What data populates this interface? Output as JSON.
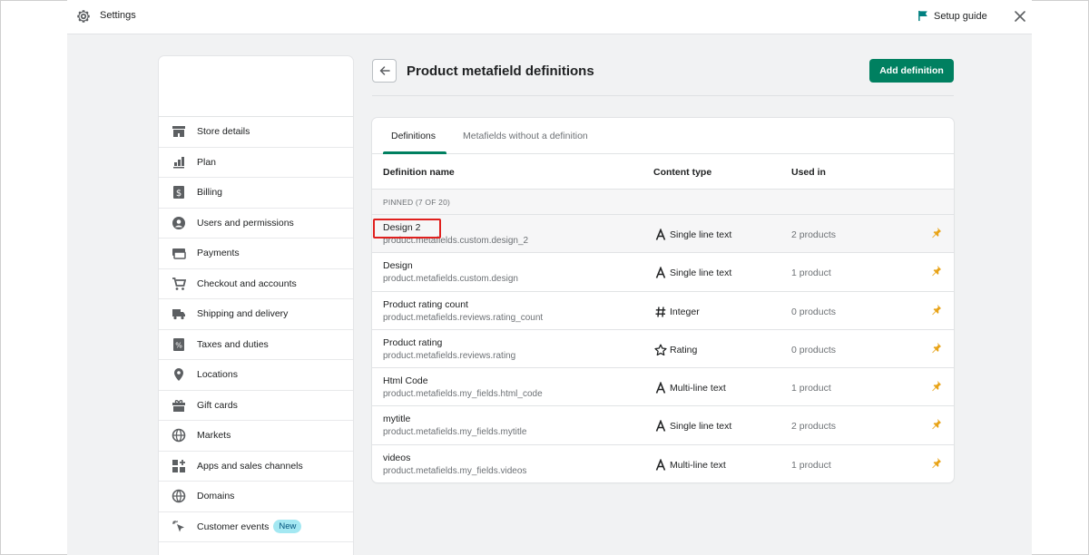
{
  "topbar": {
    "title": "Settings",
    "setup_guide": "Setup guide",
    "icons": {
      "settings": "gear-icon",
      "guide": "flag-icon",
      "close": "close-icon"
    },
    "guide_icon_color": "#008080"
  },
  "sidebar": {
    "items": [
      {
        "label": "Store details",
        "icon": "store-icon"
      },
      {
        "label": "Plan",
        "icon": "plan-icon"
      },
      {
        "label": "Billing",
        "icon": "billing-icon"
      },
      {
        "label": "Users and permissions",
        "icon": "user-icon"
      },
      {
        "label": "Payments",
        "icon": "payments-icon"
      },
      {
        "label": "Checkout and accounts",
        "icon": "cart-icon"
      },
      {
        "label": "Shipping and delivery",
        "icon": "truck-icon"
      },
      {
        "label": "Taxes and duties",
        "icon": "taxes-icon"
      },
      {
        "label": "Locations",
        "icon": "location-icon"
      },
      {
        "label": "Gift cards",
        "icon": "gift-icon"
      },
      {
        "label": "Markets",
        "icon": "globe-icon"
      },
      {
        "label": "Apps and sales channels",
        "icon": "apps-icon"
      },
      {
        "label": "Domains",
        "icon": "domains-icon"
      },
      {
        "label": "Customer events",
        "icon": "cursor-icon",
        "badge": "New"
      }
    ]
  },
  "main": {
    "title": "Product metafield definitions",
    "add_button": "Add definition",
    "accent_color": "#008060",
    "tabs": [
      {
        "label": "Definitions",
        "active": true
      },
      {
        "label": "Metafields without a definition",
        "active": false
      }
    ],
    "columns": {
      "name": "Definition name",
      "type": "Content type",
      "used": "Used in"
    },
    "section_label": "PINNED (7 OF 20)",
    "rows": [
      {
        "name": "Design 2",
        "key": "product.metafields.custom.design_2",
        "type": "Single line text",
        "type_icon": "text-icon",
        "used": "2 products",
        "highlighted": true
      },
      {
        "name": "Design",
        "key": "product.metafields.custom.design",
        "type": "Single line text",
        "type_icon": "text-icon",
        "used": "1 product",
        "highlighted": false
      },
      {
        "name": "Product rating count",
        "key": "product.metafields.reviews.rating_count",
        "type": "Integer",
        "type_icon": "hash-icon",
        "used": "0 products",
        "highlighted": false
      },
      {
        "name": "Product rating",
        "key": "product.metafields.reviews.rating",
        "type": "Rating",
        "type_icon": "star-icon",
        "used": "0 products",
        "highlighted": false
      },
      {
        "name": "Html Code",
        "key": "product.metafields.my_fields.html_code",
        "type": "Multi-line text",
        "type_icon": "text-icon",
        "used": "1 product",
        "highlighted": false
      },
      {
        "name": "mytitle",
        "key": "product.metafields.my_fields.mytitle",
        "type": "Single line text",
        "type_icon": "text-icon",
        "used": "2 products",
        "highlighted": false
      },
      {
        "name": "videos",
        "key": "product.metafields.my_fields.videos",
        "type": "Multi-line text",
        "type_icon": "text-icon",
        "used": "1 product",
        "highlighted": false
      }
    ],
    "pin_color": "#e8a317"
  }
}
